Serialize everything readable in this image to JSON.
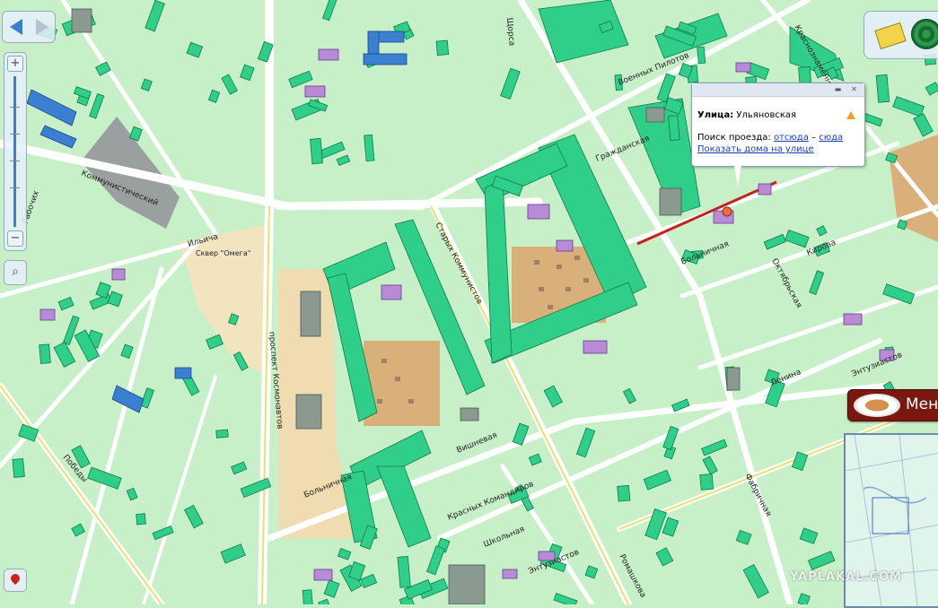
{
  "map": {
    "street_labels": [
      "Щорса",
      "Краснознамённая",
      "Военных Пилотов",
      "Гражданская",
      "Коммунистический",
      "Ильича",
      "Рабочих",
      "Сквер \"Омега\"",
      "проспект Космонавтов",
      "Старых Коммунистов",
      "Больничная",
      "Кирова",
      "Победы",
      "Красных Командиров",
      "Вишневая",
      "Школьная",
      "Энтузиастов",
      "Ленина",
      "Октябрьская",
      "Ульяновская",
      "Фабричная",
      "Ромашкова"
    ],
    "colors": {
      "background": "#c8f0c8",
      "road": "#ffffff",
      "building": "#2fcf8a",
      "sand": "#d9b97a",
      "selected_street": "#c42020",
      "public": "#b98ad6",
      "industrial": "#9aa0a0",
      "blue": "#3a7fd0"
    }
  },
  "nav": {
    "back_icon": "arrow-left-icon",
    "forward_icon": "arrow-right-icon"
  },
  "zoom": {
    "plus": "+",
    "minus": "−",
    "magnifier": "⌕"
  },
  "tools": {
    "ruler_icon": "ruler-icon",
    "radar_icon": "radar-icon"
  },
  "popup": {
    "street_label": "Улица:",
    "street_value": "Ульяновская",
    "route_label": "Поиск проезда:",
    "from_link": "отсюда",
    "dash": "–",
    "to_link": "сюда",
    "show_houses": "Показать дома на улице",
    "min_btn": "▬",
    "close_btn": "✕"
  },
  "menu": {
    "label": "Меню"
  },
  "watermark": {
    "text": "YAPLAKAL.COM"
  }
}
